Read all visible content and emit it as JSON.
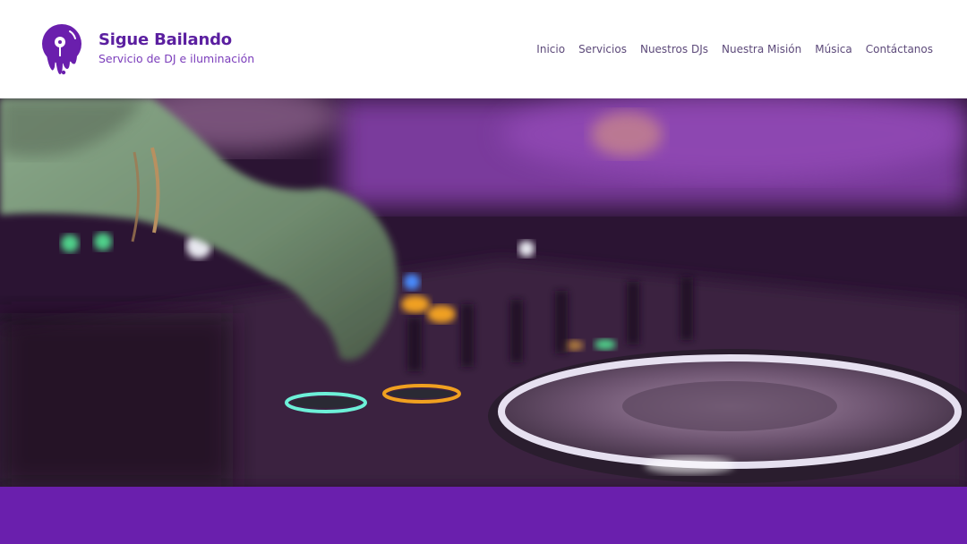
{
  "brand": {
    "title": "Sigue Bailando",
    "subtitle": "Servicio de DJ e iluminación",
    "logo_icon": "vinyl-drip-icon"
  },
  "nav": {
    "items": [
      {
        "label": "Inicio"
      },
      {
        "label": "Servicios"
      },
      {
        "label": "Nuestros DJs"
      },
      {
        "label": "Nuestra Misión"
      },
      {
        "label": "Música"
      },
      {
        "label": "Contáctanos"
      }
    ]
  },
  "hero": {
    "image": "dj-turntable-photo"
  },
  "colors": {
    "brand_purple": "#5b1fa0",
    "band_purple": "#6a1fad",
    "nav_text": "#5d4a7a"
  }
}
